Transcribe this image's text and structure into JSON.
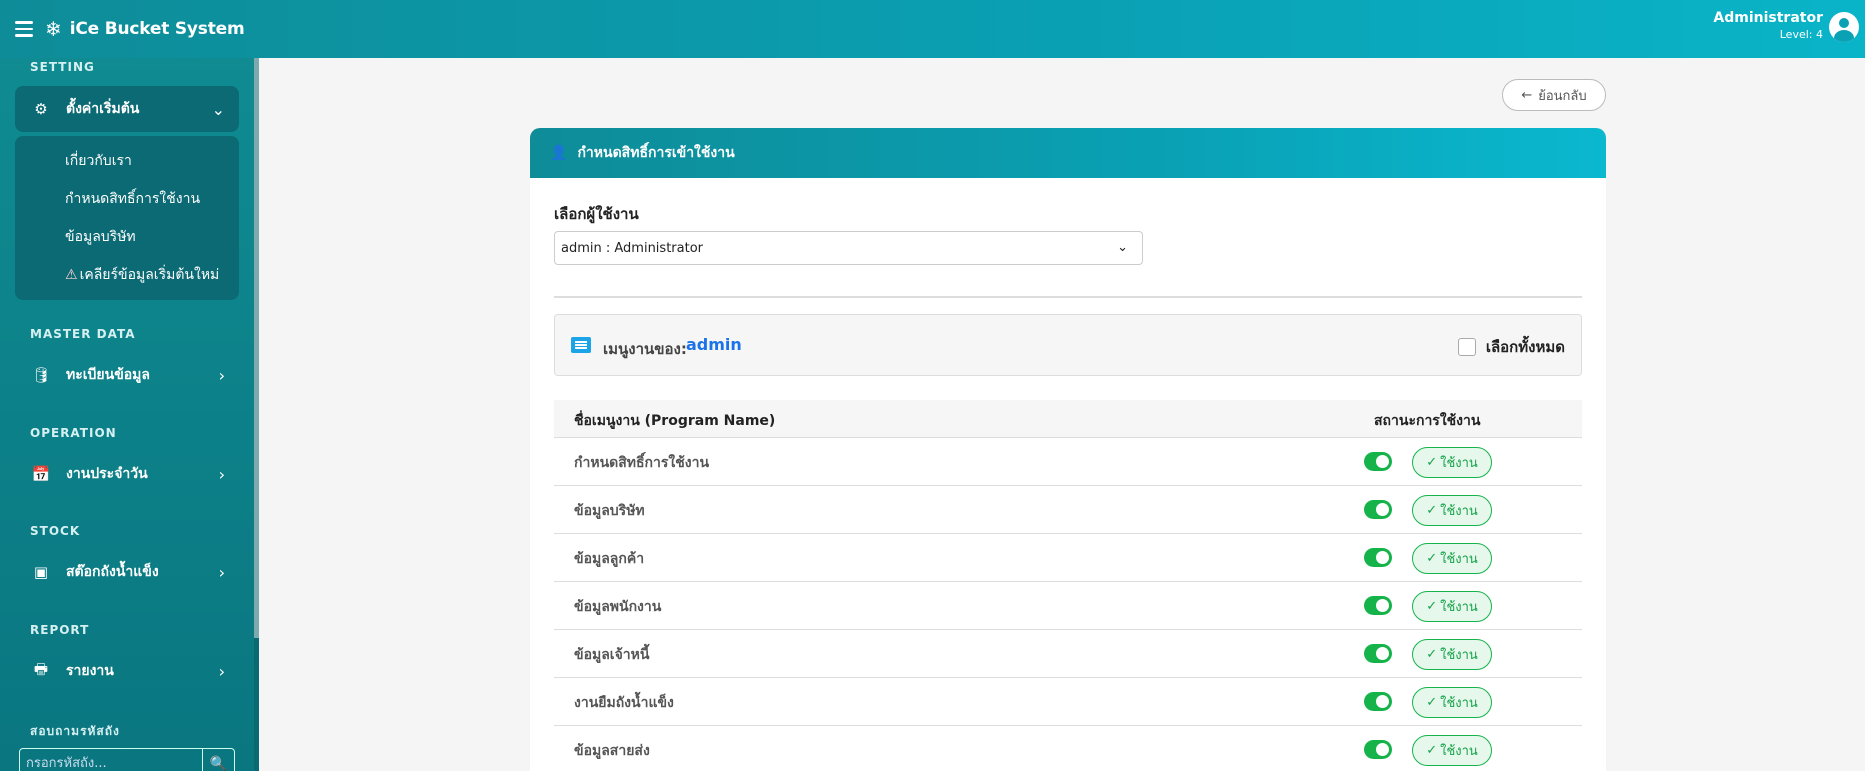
{
  "topbar": {
    "brand": "iCe Bucket System",
    "user_name": "Administrator",
    "user_level": "Level: 4"
  },
  "sidebar": {
    "sections": {
      "setting": "SETTING",
      "master_data": "MASTER DATA",
      "operation": "OPERATION",
      "stock": "STOCK",
      "report": "REPORT",
      "search": "สอบถามรหัสถัง"
    },
    "setting_item": "ตั้งค่าเริ่มต้น",
    "setting_sub": [
      "เกี่ยวกับเรา",
      "กำหนดสิทธิ์การใช้งาน",
      "ข้อมูลบริษัท",
      "เคลียร์ข้อมูลเริ่มต้นใหม่"
    ],
    "master_item": "ทะเบียนข้อมูล",
    "operation_item": "งานประจำวัน",
    "stock_item": "สต๊อกถังน้ำแข็ง",
    "report_item": "รายงาน",
    "search_placeholder": "กรอกรหัสถัง..."
  },
  "main": {
    "back_label": "ย้อนกลับ",
    "card_title": "กำหนดสิทธิ์การเข้าใช้งาน",
    "select_label": "เลือกผู้ใช้งาน",
    "select_value": "admin : Administrator",
    "menu_of_label": "เมนูงานของ:",
    "menu_of_user": "admin",
    "select_all": "เลือกทั้งหมด",
    "col_name": "ชื่อเมนูงาน (Program Name)",
    "col_status": "สถานะการใช้งาน",
    "status_label": "ใช้งาน",
    "rows": [
      {
        "name": "กำหนดสิทธิ์การใช้งาน"
      },
      {
        "name": "ข้อมูลบริษัท"
      },
      {
        "name": "ข้อมูลลูกค้า"
      },
      {
        "name": "ข้อมูลพนักงาน"
      },
      {
        "name": "ข้อมูลเจ้าหนี้"
      },
      {
        "name": "งานยืมถังน้ำแข็ง"
      },
      {
        "name": "ข้อมูลสายส่ง"
      }
    ]
  }
}
